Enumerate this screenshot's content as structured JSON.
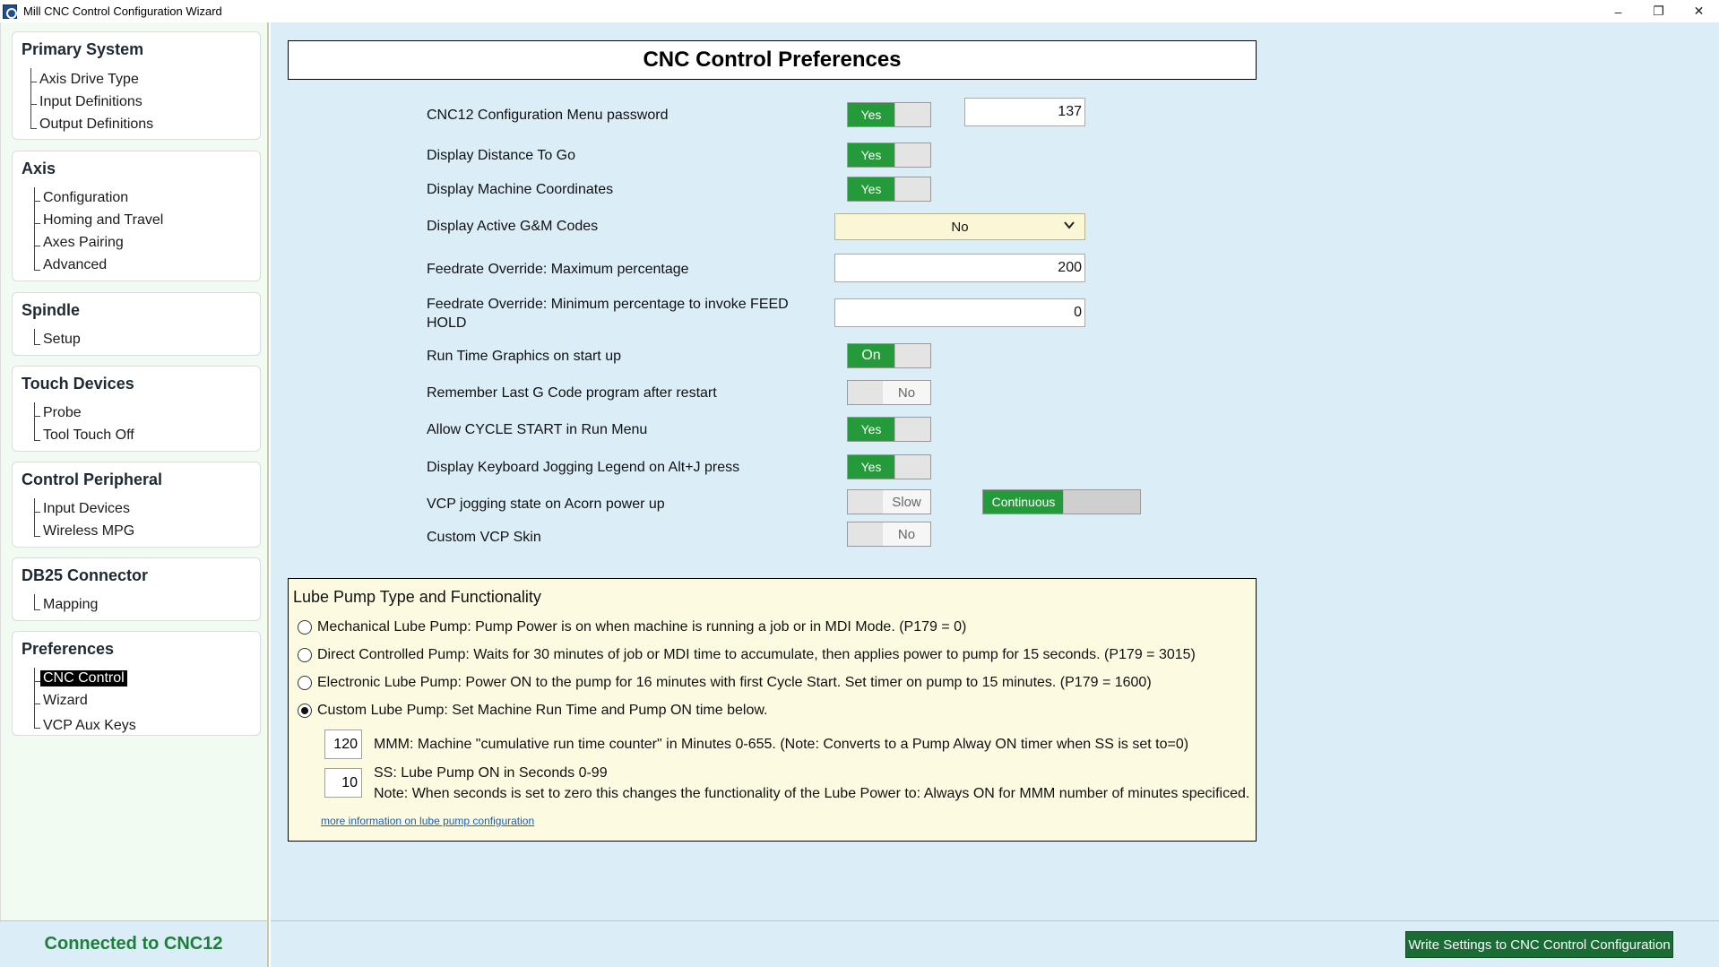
{
  "window": {
    "title": "Mill CNC Control Configuration Wizard",
    "minimize": "–",
    "maximize": "❐",
    "close": "✕"
  },
  "sidebar": {
    "groups": [
      {
        "title": "Primary System",
        "items": [
          "Axis Drive Type",
          "Input Definitions",
          "Output Definitions"
        ]
      },
      {
        "title": "Axis",
        "items": [
          "Configuration",
          "Homing and Travel",
          "Axes Pairing",
          "Advanced"
        ]
      },
      {
        "title": "Spindle",
        "items": [
          "Setup"
        ]
      },
      {
        "title": "Touch Devices",
        "items": [
          "Probe",
          "Tool Touch Off"
        ]
      },
      {
        "title": "Control Peripheral",
        "items": [
          "Input Devices",
          "Wireless MPG"
        ]
      },
      {
        "title": "DB25 Connector",
        "items": [
          "Mapping"
        ]
      },
      {
        "title": "Preferences",
        "items": [
          "CNC Control",
          "Wizard",
          "VCP Aux Keys"
        ]
      }
    ],
    "selected": "CNC Control"
  },
  "main": {
    "title": "CNC Control Preferences",
    "settings": [
      {
        "label": "CNC12 Configuration Menu password",
        "toggle": "Yes",
        "value": "137"
      },
      {
        "label": "Display Distance To Go",
        "toggle": "Yes"
      },
      {
        "label": "Display Machine Coordinates",
        "toggle": "Yes"
      },
      {
        "label": "Display Active G&M Codes",
        "dropdown": "No"
      },
      {
        "label": "Feedrate Override: Maximum percentage",
        "value": "200"
      },
      {
        "label": "Feedrate Override: Minimum percentage to invoke FEED HOLD",
        "value": "0"
      },
      {
        "label": "Run Time Graphics on start up",
        "toggle": "On"
      },
      {
        "label": "Remember Last G Code program after restart",
        "toggle": "No"
      },
      {
        "label": "Allow CYCLE START in Run Menu",
        "toggle": "Yes"
      },
      {
        "label": "Display Keyboard Jogging Legend on Alt+J press",
        "toggle": "Yes"
      },
      {
        "label": "VCP jogging state on Acorn power up",
        "toggle": "Slow",
        "toggle2": "Continuous"
      },
      {
        "label": "Custom VCP Skin",
        "toggle": "No"
      }
    ]
  },
  "lube": {
    "title": "Lube Pump Type and Functionality",
    "options": [
      "Mechanical Lube Pump: Pump Power is on when machine is running a job or in MDI Mode. (P179 = 0)",
      "Direct Controlled Pump: Waits for 30 minutes of job or MDI time to accumulate, then applies power to pump for 15 seconds. (P179 = 3015)",
      "Electronic Lube Pump: Power ON to the pump for 16 minutes with first Cycle Start. Set timer on pump to 15 minutes. (P179 = 1600)",
      "Custom Lube Pump: Set Machine Run Time and Pump ON time below."
    ],
    "selected_index": 3,
    "mmm_value": "120",
    "mmm_text": "MMM: Machine \"cumulative run time counter\" in Minutes 0-655.  (Note: Converts to a Pump Alway ON timer when SS is set to=0)",
    "ss_value": "10",
    "ss_text": "SS: Lube Pump ON in Seconds 0-99",
    "ss_note": "Note: When seconds is set to zero this changes the functionality of the Lube Power to: Always ON for MMM number of minutes specificed.",
    "link": "more information on lube pump configuration"
  },
  "status": {
    "connection": "Connected to CNC12",
    "write_button": "Write Settings to CNC Control Configuration"
  },
  "colors": {
    "toggle_on": "#249a3a",
    "main_bg": "#dbeef7",
    "sidebar_bg": "#f2fbf2",
    "lube_bg": "#fcfbe1",
    "write_button": "#1b6b35",
    "connected_text": "#1f7f3a"
  }
}
